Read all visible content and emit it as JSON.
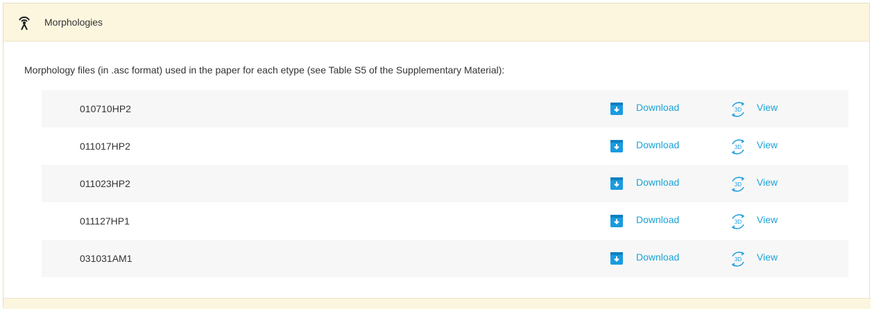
{
  "panel": {
    "title": "Morphologies",
    "icon": "antenna-icon",
    "description": "Morphology files (in .asc format) used in the paper for each etype (see Table S5 of the Supplementary Material):"
  },
  "rows": [
    {
      "name": "010710HP2",
      "download_label": "Download",
      "view_label": "View"
    },
    {
      "name": "011017HP2",
      "download_label": "Download",
      "view_label": "View"
    },
    {
      "name": "011023HP2",
      "download_label": "Download",
      "view_label": "View"
    },
    {
      "name": "011127HP1",
      "download_label": "Download",
      "view_label": "View"
    },
    {
      "name": "031031AM1",
      "download_label": "Download",
      "view_label": "View"
    }
  ],
  "colors": {
    "header_bg": "#fcf6df",
    "link": "#1aa3d8",
    "row_alt_bg": "#f7f7f7",
    "download_icon": "#1a9be0"
  }
}
